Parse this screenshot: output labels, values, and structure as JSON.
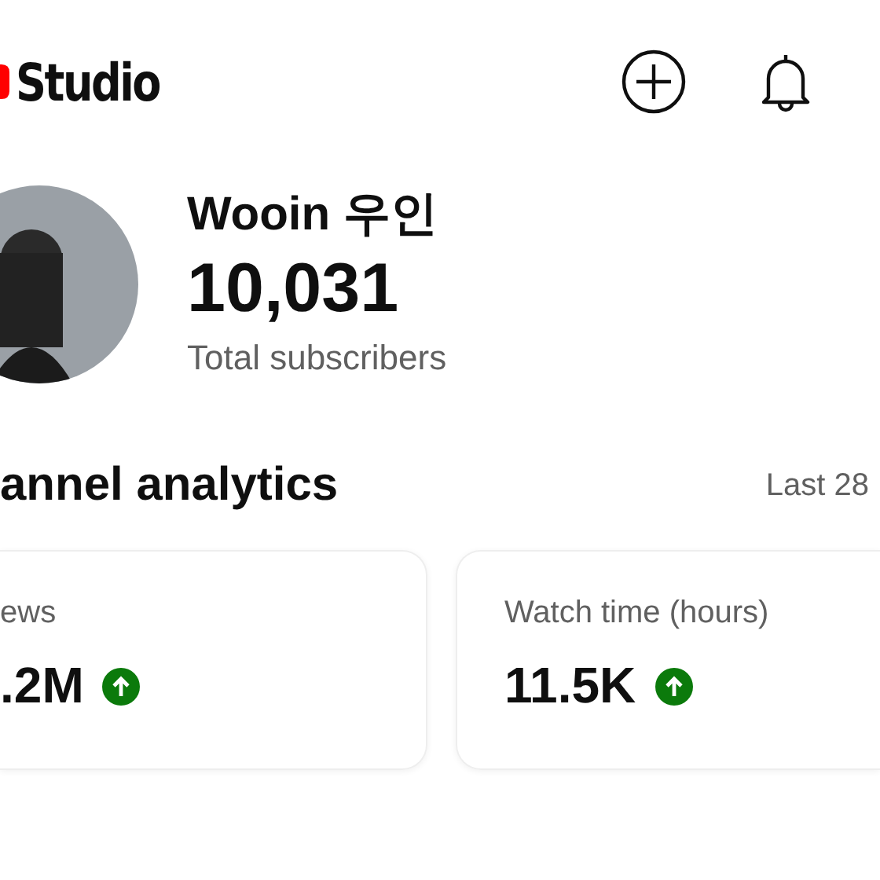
{
  "header": {
    "logo_text": "Studio"
  },
  "channel": {
    "name": "Wooin 우인",
    "subscribers": "10,031",
    "subscribers_label": "Total subscribers"
  },
  "analytics": {
    "title": "annel analytics",
    "period": "Last 28",
    "cards": [
      {
        "label": "ews",
        "value": ".2M",
        "rising": true
      },
      {
        "label": "Watch time (hours)",
        "value": "11.5K",
        "rising": true
      }
    ]
  }
}
